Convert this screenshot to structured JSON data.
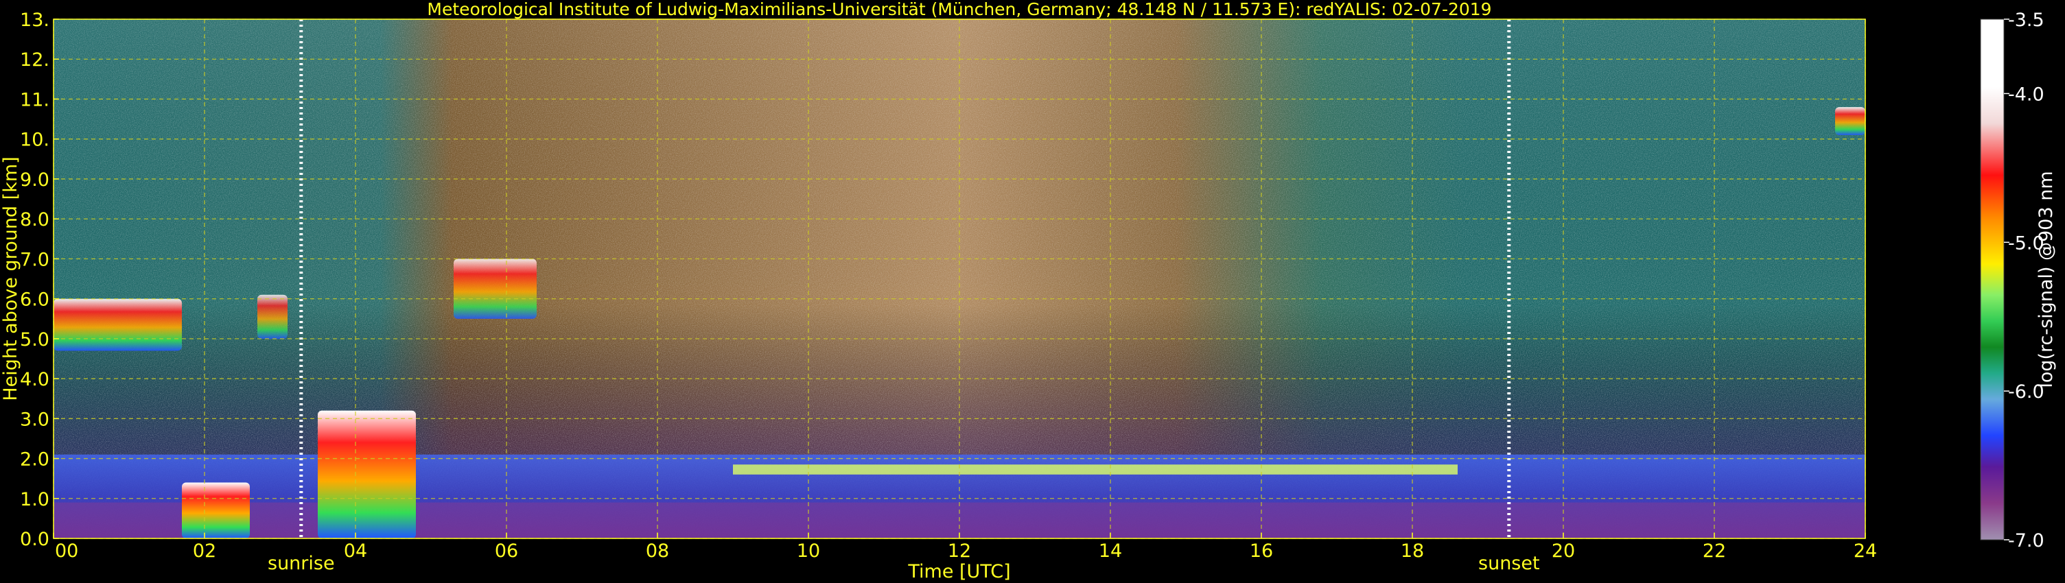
{
  "chart_data": {
    "type": "heatmap",
    "title": "Meteorological Institute of Ludwig-Maximilians-Universität (München, Germany; 48.148 N / 11.573 E):    redYALIS: 02-07-2019",
    "xlabel": "Time [UTC]",
    "ylabel": "Height above ground [km]",
    "xlim": [
      0,
      24
    ],
    "ylim": [
      0,
      13
    ],
    "xticks": [
      "00",
      "02",
      "04",
      "06",
      "08",
      "10",
      "12",
      "14",
      "16",
      "18",
      "20",
      "22",
      "24"
    ],
    "yticks": [
      "0.0",
      "1.0",
      "2.0",
      "3.0",
      "4.0",
      "5.0",
      "6.0",
      "7.0",
      "8.0",
      "9.0",
      "10.",
      "11.",
      "12.",
      "13."
    ],
    "grid": true,
    "annotations": [
      {
        "label": "sunrise",
        "time": 3.28
      },
      {
        "label": "sunset",
        "time": 19.28
      }
    ],
    "colorbar": {
      "label": "log(rc-signal) @903 nm",
      "range": [
        -7.0,
        -3.5
      ],
      "ticks": [
        "-3.5",
        "-4.0",
        "-5.0",
        "-6.0",
        "-7.0"
      ]
    },
    "features": [
      {
        "kind": "cloud",
        "t0": 0.0,
        "t1": 1.7,
        "h0": 4.7,
        "h1": 6.0,
        "strength": 0.9
      },
      {
        "kind": "cloud",
        "t0": 2.7,
        "t1": 3.1,
        "h0": 5.0,
        "h1": 6.1,
        "strength": 0.8
      },
      {
        "kind": "cloud",
        "t0": 1.7,
        "t1": 2.6,
        "h0": 0.0,
        "h1": 1.4,
        "strength": 1.0
      },
      {
        "kind": "cloud",
        "t0": 3.5,
        "t1": 4.8,
        "h0": 0.0,
        "h1": 3.2,
        "strength": 1.0
      },
      {
        "kind": "cloud",
        "t0": 5.3,
        "t1": 6.4,
        "h0": 5.5,
        "h1": 7.0,
        "strength": 0.85
      },
      {
        "kind": "cloud",
        "t0": 23.6,
        "t1": 24.0,
        "h0": 10.1,
        "h1": 10.8,
        "strength": 0.9
      },
      {
        "kind": "cloud_top",
        "t0": 9.0,
        "t1": 18.6,
        "h": 1.7
      }
    ]
  }
}
